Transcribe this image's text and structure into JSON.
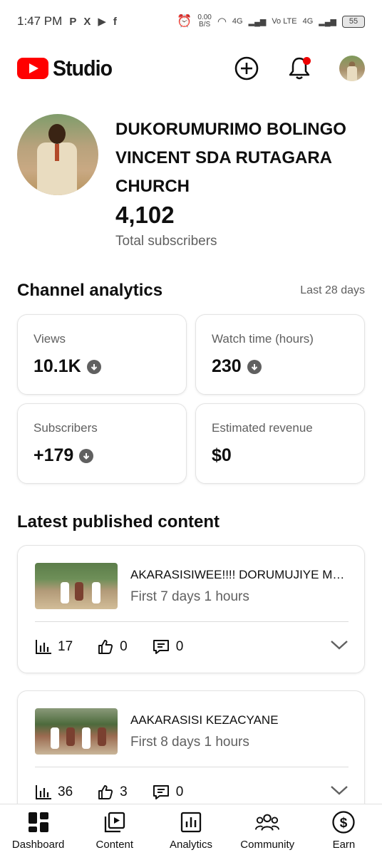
{
  "status_bar": {
    "time": "1:47 PM",
    "notification_icons": [
      "P",
      "X",
      "▶",
      "f"
    ],
    "net_speed_value": "0.00",
    "net_speed_unit": "B/S",
    "network_1": "4G",
    "volte": "Vo LTE",
    "network_2": "4G",
    "battery": "55"
  },
  "header": {
    "logo_text": "Studio",
    "icons": [
      "create-icon",
      "notifications-icon",
      "account-avatar"
    ]
  },
  "channel": {
    "name": "DUKORUMURIMO BOLINGO VINCENT SDA RUTAGARA CHURCH",
    "subscriber_count": "4,102",
    "subscriber_label": "Total subscribers"
  },
  "analytics": {
    "title": "Channel analytics",
    "period": "Last 28 days",
    "cards": [
      {
        "label": "Views",
        "value": "10.1K",
        "trend": "down"
      },
      {
        "label": "Watch time (hours)",
        "value": "230",
        "trend": "down"
      },
      {
        "label": "Subscribers",
        "value": "+179",
        "trend": "down"
      },
      {
        "label": "Estimated revenue",
        "value": "$0",
        "trend": "none"
      }
    ]
  },
  "latest": {
    "title": "Latest published content",
    "videos": [
      {
        "title": "AKARASISIWEE!!!! DORUMUJIYE MUNKAMBI!!!",
        "subtitle": "First 7 days 1 hours",
        "views": "17",
        "likes": "0",
        "comments": "0"
      },
      {
        "title": "AAKARASISI KEZACYANE",
        "subtitle": "First 8 days 1 hours",
        "views": "36",
        "likes": "3",
        "comments": "0"
      }
    ]
  },
  "bottom_nav": [
    {
      "label": "Dashboard",
      "icon": "dashboard-icon"
    },
    {
      "label": "Content",
      "icon": "content-icon"
    },
    {
      "label": "Analytics",
      "icon": "analytics-icon"
    },
    {
      "label": "Community",
      "icon": "community-icon"
    },
    {
      "label": "Earn",
      "icon": "earn-icon"
    }
  ],
  "colors": {
    "brand_red": "#ff0000",
    "notification_dot": "#ee0000",
    "secondary_text": "#606060"
  }
}
